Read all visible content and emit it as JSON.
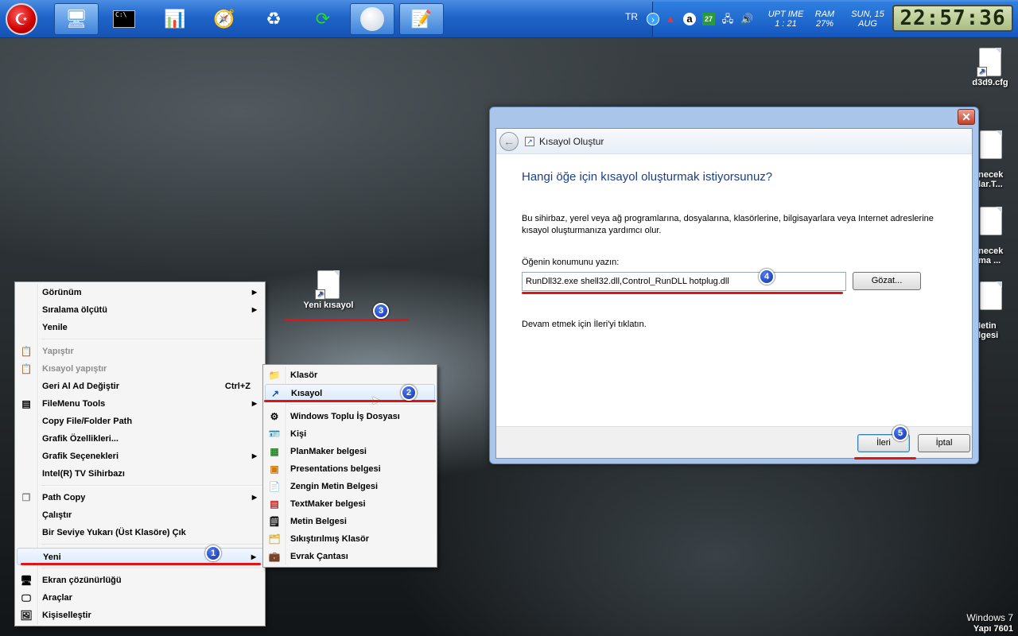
{
  "taskbar": {
    "start_icon": "start-orb-icon",
    "buttons": [
      "my-computer-icon",
      "cmd-icon",
      "task-manager-icon",
      "compass-icon",
      "recycle-bin-icon",
      "refresh-icon",
      "orb-icon",
      "notepad-icon"
    ],
    "language": "TR",
    "uptime_label": "UPT IME",
    "uptime_value": "1 : 21",
    "ram_label": "RAM",
    "ram_value": "27%",
    "date_line1": "SUN, 15",
    "date_line2": "AUG",
    "clock": "22:57:36",
    "tray_badge": "27"
  },
  "desktop": {
    "right_icons": [
      {
        "label": "d3d9.cfg"
      },
      {
        "label": "enecek\nalar.T..."
      },
      {
        "label": "enecek\nema ..."
      },
      {
        "label": "Metin\nelgesi"
      }
    ],
    "new_shortcut_label": "Yeni kısayol",
    "watermark_line1": "Windows 7",
    "watermark_line2": "Yapı 7601"
  },
  "context_menu": {
    "items": [
      {
        "label": "Görünüm",
        "arrow": "▶"
      },
      {
        "label": "Sıralama ölçütü",
        "arrow": "▶"
      },
      {
        "label": "Yenile"
      },
      {
        "label": "Yapıştır"
      },
      {
        "label": "Kısayol yapıştır"
      },
      {
        "label": "Geri Al Ad Değiştir",
        "shortcut": "Ctrl+Z"
      },
      {
        "label": "FileMenu Tools",
        "arrow": "▶"
      },
      {
        "label": "Copy File/Folder Path"
      },
      {
        "label": "Grafik Özellikleri..."
      },
      {
        "label": "Grafik Seçenekleri",
        "arrow": "▶"
      },
      {
        "label": "Intel(R) TV Sihirbazı"
      },
      {
        "label": "Path Copy",
        "arrow": "▶"
      },
      {
        "label": "Çalıştır"
      },
      {
        "label": "Bir Seviye Yukarı (Üst Klasöre) Çık"
      },
      {
        "label": "Yeni",
        "arrow": "▶"
      },
      {
        "label": "Ekran çözünürlüğü"
      },
      {
        "label": "Araçlar"
      },
      {
        "label": "Kişiselleştir"
      }
    ]
  },
  "submenu": {
    "items": [
      {
        "label": "Klasör"
      },
      {
        "label": "Kısayol"
      },
      {
        "label": "Windows Toplu İş Dosyası"
      },
      {
        "label": "Kişi"
      },
      {
        "label": "PlanMaker belgesi"
      },
      {
        "label": "Presentations belgesi"
      },
      {
        "label": "Zengin Metin Belgesi"
      },
      {
        "label": "TextMaker belgesi"
      },
      {
        "label": "Metin Belgesi"
      },
      {
        "label": "Sıkıştırılmış Klasör"
      },
      {
        "label": "Evrak Çantası"
      }
    ]
  },
  "dialog": {
    "title": "Kısayol Oluştur",
    "close": "✕",
    "heading": "Hangi öğe için kısayol oluşturmak istiyorsunuz?",
    "description": "Bu sihirbaz, yerel veya ağ programlarına, dosyalarına, klasörlerine, bilgisayarlara veya Internet adreslerine kısayol oluşturmanıza yardımcı olur.",
    "location_label": "Öğenin konumunu yazın:",
    "location_value": "RunDll32.exe shell32.dll,Control_RunDLL hotplug.dll",
    "browse_label": "Gözat...",
    "continue_text": "Devam etmek için İleri'yi tıklatın.",
    "next_label": "İleri",
    "cancel_label": "İptal"
  },
  "annotations": [
    "1",
    "2",
    "3",
    "4",
    "5"
  ],
  "colors": {
    "accent_red": "#e01414",
    "badge_blue": "#1432a8",
    "heading_blue": "#1a3f8b"
  }
}
